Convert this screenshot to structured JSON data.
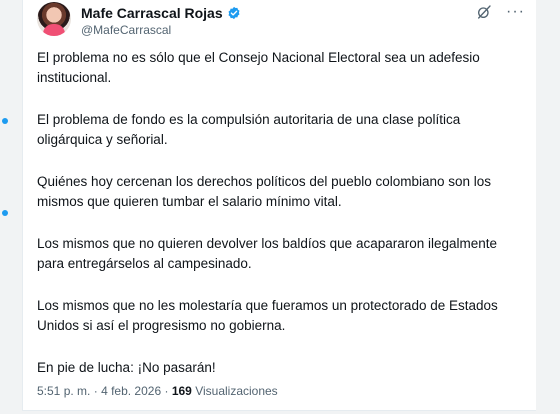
{
  "author": {
    "name": "Mafe Carrascal Rojas",
    "handle": "@MafeCarrascal",
    "verified_color": "#1d9bf0"
  },
  "icons": {
    "verified": "verified-badge-icon",
    "grok": "grok-icon",
    "more": "more-options-icon"
  },
  "more_glyph": "···",
  "paragraphs": [
    "El problema no es sólo que el Consejo Nacional Electoral sea un adefesio institucional.",
    "El problema de fondo es la compulsión autoritaria de una clase política oligárquica y señorial.",
    "Quiénes hoy cercenan los derechos políticos del pueblo colombiano son los mismos que quieren tumbar el salario mínimo vital.",
    "Los mismos que no quieren devolver los baldíos que acapararon ilegalmente para entregárselos al campesinado.",
    "Los mismos que no les molestaría que fueramos un protectorado de Estados Unidos si así el progresismo no gobierna.",
    "En pie de lucha: ¡No pasarán!"
  ],
  "meta": {
    "time": "5:51 p. m.",
    "separator": "·",
    "date": "4 feb. 2026",
    "views_count": "169",
    "views_label": "Visualizaciones"
  }
}
